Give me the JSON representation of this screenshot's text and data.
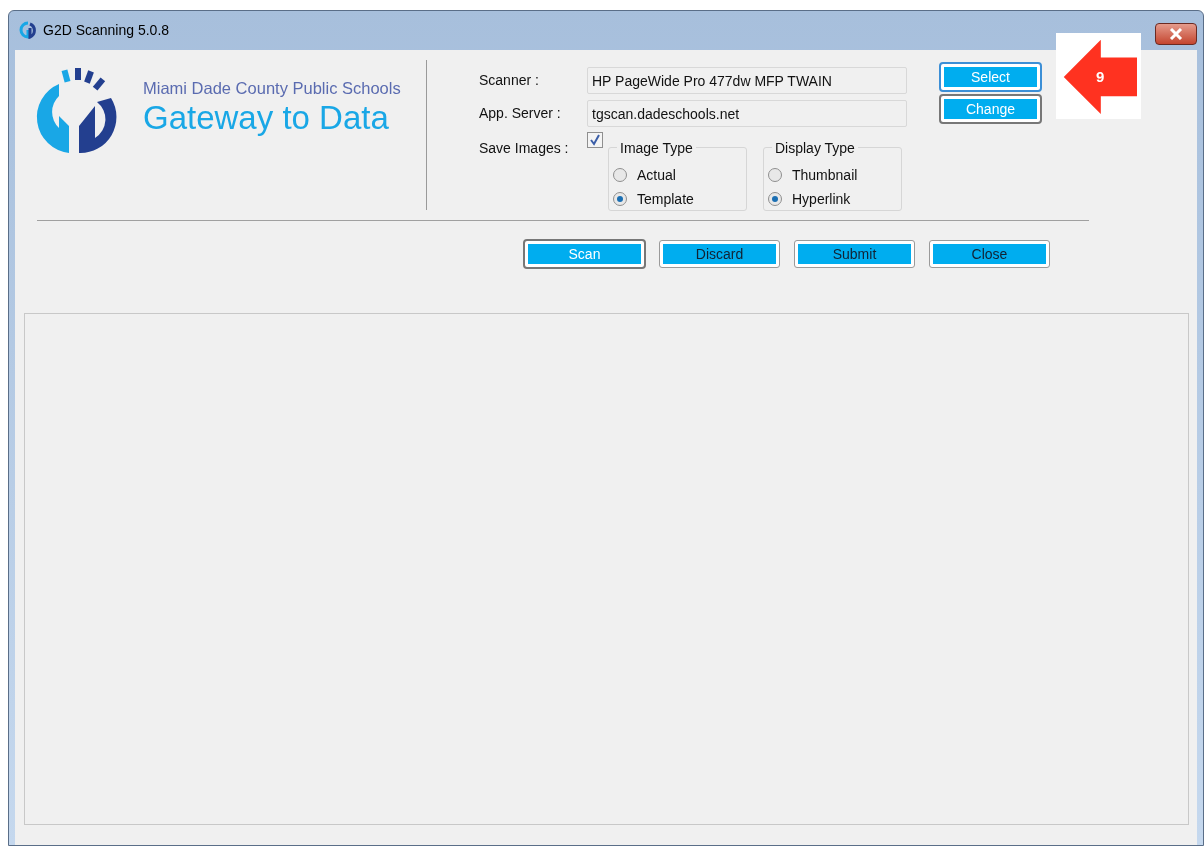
{
  "window": {
    "title": "G2D Scanning 5.0.8"
  },
  "logo": {
    "subtitle": "Miami Dade County Public Schools",
    "title": "Gateway to Data"
  },
  "fields": [
    {
      "label": "Scanner :",
      "value": "HP PageWide Pro 477dw MFP TWAIN"
    },
    {
      "label": "App. Server :",
      "value": "tgscan.dadeschools.net"
    }
  ],
  "save_images": {
    "label": "Save Images :",
    "checked": true
  },
  "groups": [
    {
      "title": "Image Type",
      "options": [
        {
          "label": "Actual",
          "selected": false
        },
        {
          "label": "Template",
          "selected": true
        }
      ]
    },
    {
      "title": "Display Type",
      "options": [
        {
          "label": "Thumbnail",
          "selected": false
        },
        {
          "label": "Hyperlink",
          "selected": true
        }
      ]
    }
  ],
  "side_buttons": [
    {
      "label": "Select",
      "focused": true
    },
    {
      "label": "Change",
      "focused": false
    }
  ],
  "callout": {
    "label": "9"
  },
  "action_buttons": [
    {
      "label": "Scan",
      "kind": "default"
    },
    {
      "label": "Discard",
      "kind": "normal"
    },
    {
      "label": "Submit",
      "kind": "normal"
    },
    {
      "label": "Close",
      "kind": "normal"
    }
  ]
}
